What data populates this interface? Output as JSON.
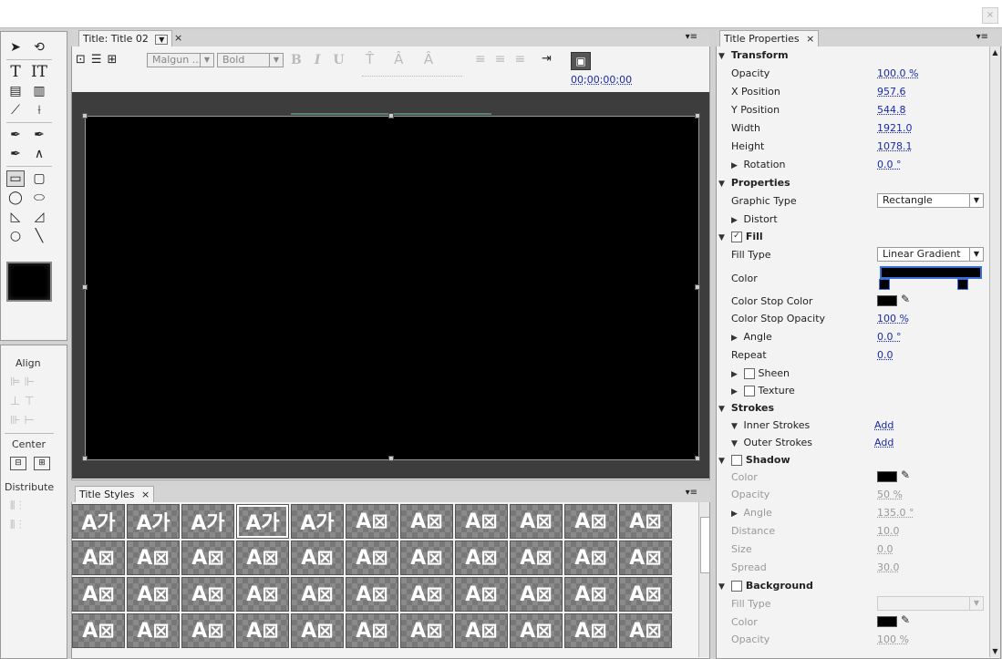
{
  "window": {
    "close_glyph": "×"
  },
  "tools": {
    "icons": [
      "selection-arrow-icon",
      "rotate-icon",
      "type-icon",
      "vertical-type-icon",
      "area-type-icon",
      "vertical-area-type-icon",
      "path-type-icon",
      "vertical-path-type-icon",
      "pen-icon",
      "delete-anchor-icon",
      "add-anchor-icon",
      "convert-anchor-icon",
      "rectangle-icon",
      "rounded-rectangle-icon",
      "ellipse-icon",
      "rounded-pill-icon",
      "wedge-icon",
      "arc-icon",
      "circle-icon",
      "line-icon"
    ],
    "align_label": "Align",
    "center_label": "Center",
    "distribute_label": "Distribute"
  },
  "title_panel": {
    "tab_label": "Title: Title 02",
    "font_family": "Malgun ...",
    "font_style": "Bold",
    "timecode": "00;00;00;00",
    "menu_glyph": "▾≡"
  },
  "styles_panel": {
    "tab_label": "Title Styles",
    "rows": [
      [
        "A가",
        "A가",
        "A가",
        "A가",
        "A가",
        "A⊠",
        "A⊠",
        "A⊠",
        "A⊠",
        "A⊠",
        "A⊠"
      ],
      [
        "A⊠",
        "A⊠",
        "A⊠",
        "A⊠",
        "A⊠",
        "A⊠",
        "A⊠",
        "A⊠",
        "A⊠",
        "A⊠",
        "A⊠"
      ],
      [
        "A⊠",
        "A⊠",
        "A⊠",
        "A⊠",
        "A⊠",
        "A⊠",
        "A⊠",
        "A⊠",
        "A⊠",
        "A⊠",
        "A⊠"
      ],
      [
        "A⊠",
        "A⊠",
        "A⊠",
        "A⊠",
        "A⊠",
        "A⊠",
        "A⊠",
        "A⊠",
        "A⊠",
        "A⊠",
        "A⊠"
      ]
    ]
  },
  "properties": {
    "tab_label": "Title Properties",
    "transform": "Transform",
    "opacity_label": "Opacity",
    "opacity": "100.0 %",
    "xpos_label": "X Position",
    "xpos": "957.6",
    "ypos_label": "Y Position",
    "ypos": "544.8",
    "width_label": "Width",
    "width": "1921.0",
    "height_label": "Height",
    "height": "1078.1",
    "rotation_label": "Rotation",
    "rotation": "0.0 °",
    "properties": "Properties",
    "graphic_type_label": "Graphic Type",
    "graphic_type": "Rectangle",
    "distort_label": "Distort",
    "fill_label": "Fill",
    "fill_type_label": "Fill Type",
    "fill_type": "Linear Gradient",
    "color_label": "Color",
    "stop_color_label": "Color Stop Color",
    "stop_opacity_label": "Color Stop Opacity",
    "stop_opacity": "100 %",
    "angle_label": "Angle",
    "angle": "0.0 °",
    "repeat_label": "Repeat",
    "repeat": "0.0",
    "sheen_label": "Sheen",
    "texture_label": "Texture",
    "strokes_label": "Strokes",
    "inner_strokes_label": "Inner Strokes",
    "inner_add": "Add",
    "outer_strokes_label": "Outer Strokes",
    "outer_add": "Add",
    "shadow_label": "Shadow",
    "sh_color_label": "Color",
    "sh_opacity_label": "Opacity",
    "sh_opacity": "50 %",
    "sh_angle_label": "Angle",
    "sh_angle": "135.0 °",
    "sh_distance_label": "Distance",
    "sh_distance": "10.0",
    "sh_size_label": "Size",
    "sh_size": "0.0",
    "sh_spread_label": "Spread",
    "sh_spread": "30.0",
    "background_label": "Background",
    "bg_fill_type_label": "Fill Type",
    "bg_color_label": "Color",
    "bg_opacity_label": "Opacity",
    "bg_opacity": "100 %"
  }
}
